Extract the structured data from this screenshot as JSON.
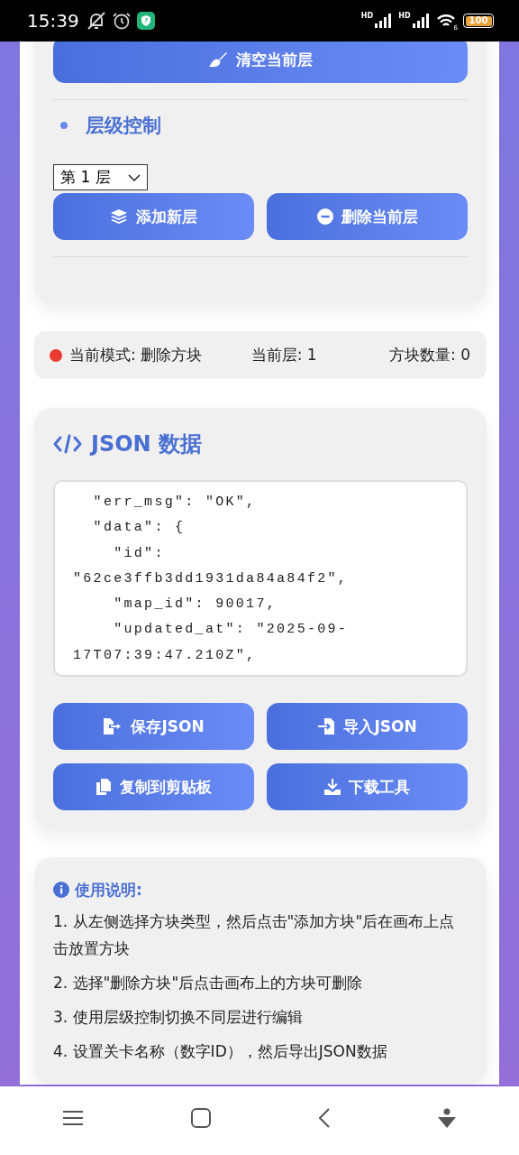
{
  "status_bar": {
    "time": "15:39",
    "signal_labels": [
      "HD",
      "HD"
    ],
    "wifi_label": "6",
    "battery": "100"
  },
  "layer_card": {
    "clear_button": "清空当前层",
    "section_title": "层级控制",
    "layer_select": {
      "value": "第 1 层"
    },
    "buttons": [
      "添加新层",
      "删除当前层"
    ]
  },
  "status_panel": {
    "mode": "当前模式: 删除方块",
    "layer": "当前层: 1",
    "count": "方块数量: 0"
  },
  "json_card": {
    "title": "JSON 数据",
    "lines": [
      "  \"err_msg\": \"OK\",",
      "  \"data\": {",
      "    \"id\":",
      "\"62ce3ffb3dd1931da84a84f2\",",
      "    \"map_id\": 90017,",
      "    \"updated_at\": \"2025-09-",
      "17T07:39:47.210Z\","
    ],
    "buttons": [
      "保存JSON",
      "导入JSON",
      "复制到剪贴板",
      "下载工具"
    ]
  },
  "instructions": {
    "title": "使用说明:",
    "items": [
      "1. 从左侧选择方块类型，然后点击\"添加方块\"后在画布上点击放置方块",
      "2. 选择\"删除方块\"后点击画布上的方块可删除",
      "3. 使用层级控制切换不同层进行编辑",
      "4. 设置关卡名称（数字ID），然后导出JSON数据"
    ]
  }
}
